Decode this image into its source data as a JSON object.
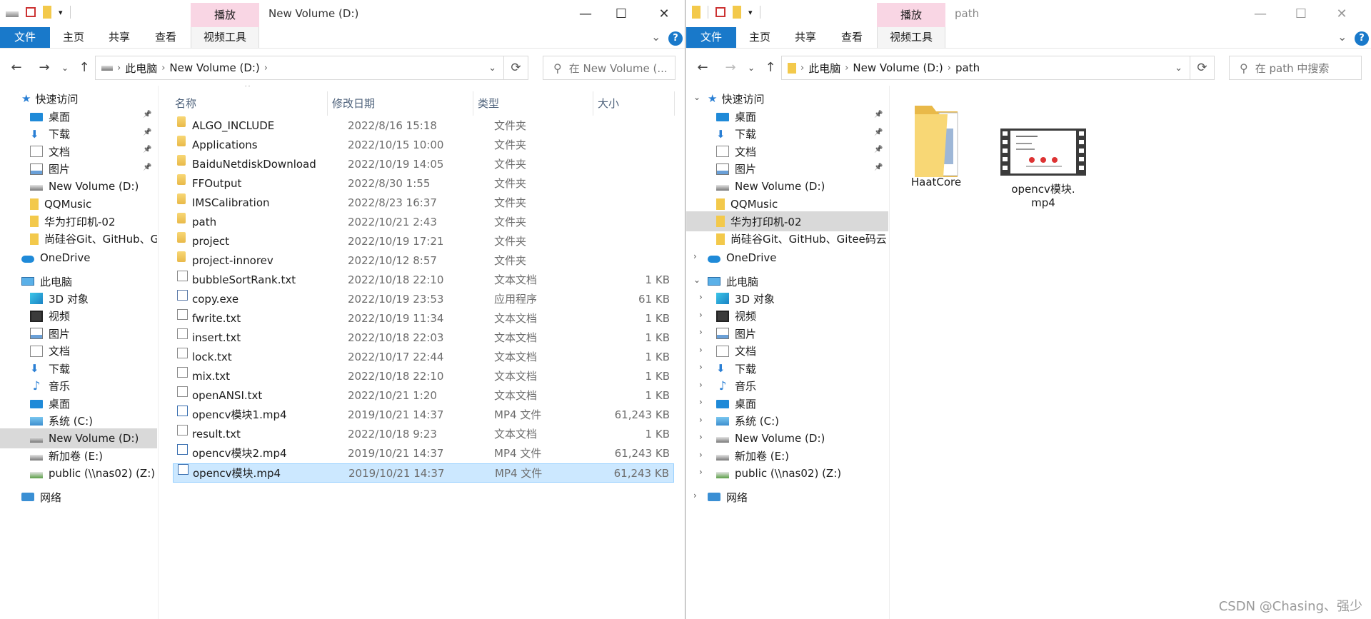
{
  "left": {
    "title": "New Volume (D:)",
    "context_tab_label": "播放",
    "ribbon_tabs": [
      "文件",
      "主页",
      "共享",
      "查看",
      "视频工具"
    ],
    "address": {
      "crumbs": [
        "此电脑",
        "New Volume (D:)"
      ]
    },
    "search_placeholder": "在 New Volume (...",
    "columns": {
      "name": "名称",
      "date": "修改日期",
      "type": "类型",
      "size": "大小"
    },
    "nav": {
      "quick_access": "快速访问",
      "quick_items": [
        "桌面",
        "下载",
        "文档",
        "图片",
        "New Volume (D:)",
        "QQMusic",
        "华为打印机-02",
        "尚硅谷Git、GitHub、G"
      ],
      "onedrive": "OneDrive",
      "this_pc": "此电脑",
      "pc_items": [
        "3D 对象",
        "视频",
        "图片",
        "文档",
        "下载",
        "音乐",
        "桌面",
        "系统 (C:)",
        "New Volume (D:)",
        "新加卷 (E:)",
        "public (\\\\nas02) (Z:)"
      ],
      "network": "网络"
    },
    "files": [
      {
        "name": "ALGO_INCLUDE",
        "date": "2022/8/16 15:18",
        "type": "文件夹",
        "size": "",
        "icon": "folder"
      },
      {
        "name": "Applications",
        "date": "2022/10/15 10:00",
        "type": "文件夹",
        "size": "",
        "icon": "folder"
      },
      {
        "name": "BaiduNetdiskDownload",
        "date": "2022/10/19 14:05",
        "type": "文件夹",
        "size": "",
        "icon": "folder"
      },
      {
        "name": "FFOutput",
        "date": "2022/8/30 1:55",
        "type": "文件夹",
        "size": "",
        "icon": "folder"
      },
      {
        "name": "IMSCalibration",
        "date": "2022/8/23 16:37",
        "type": "文件夹",
        "size": "",
        "icon": "folder"
      },
      {
        "name": "path",
        "date": "2022/10/21 2:43",
        "type": "文件夹",
        "size": "",
        "icon": "folder"
      },
      {
        "name": "project",
        "date": "2022/10/19 17:21",
        "type": "文件夹",
        "size": "",
        "icon": "folder"
      },
      {
        "name": "project-innorev",
        "date": "2022/10/12 8:57",
        "type": "文件夹",
        "size": "",
        "icon": "folder"
      },
      {
        "name": "bubbleSortRank.txt",
        "date": "2022/10/18 22:10",
        "type": "文本文档",
        "size": "1 KB",
        "icon": "file"
      },
      {
        "name": "copy.exe",
        "date": "2022/10/19 23:53",
        "type": "应用程序",
        "size": "61 KB",
        "icon": "exe"
      },
      {
        "name": "fwrite.txt",
        "date": "2022/10/19 11:34",
        "type": "文本文档",
        "size": "1 KB",
        "icon": "file"
      },
      {
        "name": "insert.txt",
        "date": "2022/10/18 22:03",
        "type": "文本文档",
        "size": "1 KB",
        "icon": "file"
      },
      {
        "name": "lock.txt",
        "date": "2022/10/17 22:44",
        "type": "文本文档",
        "size": "1 KB",
        "icon": "file"
      },
      {
        "name": "mix.txt",
        "date": "2022/10/18 22:10",
        "type": "文本文档",
        "size": "1 KB",
        "icon": "file"
      },
      {
        "name": "openANSI.txt",
        "date": "2022/10/21 1:20",
        "type": "文本文档",
        "size": "1 KB",
        "icon": "file"
      },
      {
        "name": "opencv模块1.mp4",
        "date": "2019/10/21 14:37",
        "type": "MP4 文件",
        "size": "61,243 KB",
        "icon": "mp4"
      },
      {
        "name": "result.txt",
        "date": "2022/10/18 9:23",
        "type": "文本文档",
        "size": "1 KB",
        "icon": "file"
      },
      {
        "name": "opencv模块2.mp4",
        "date": "2019/10/21 14:37",
        "type": "MP4 文件",
        "size": "61,243 KB",
        "icon": "mp4"
      },
      {
        "name": "opencv模块.mp4",
        "date": "2019/10/21 14:37",
        "type": "MP4 文件",
        "size": "61,243 KB",
        "icon": "mp4",
        "selected": true
      }
    ]
  },
  "right": {
    "title": "path",
    "context_tab_label": "播放",
    "ribbon_tabs": [
      "文件",
      "主页",
      "共享",
      "查看",
      "视频工具"
    ],
    "address": {
      "crumbs": [
        "此电脑",
        "New Volume (D:)",
        "path"
      ]
    },
    "search_placeholder": "在 path 中搜索",
    "nav": {
      "quick_access": "快速访问",
      "quick_items": [
        "桌面",
        "下载",
        "文档",
        "图片",
        "New Volume (D:)",
        "QQMusic",
        "华为打印机-02",
        "尚硅谷Git、GitHub、Gitee码云"
      ],
      "onedrive": "OneDrive",
      "this_pc": "此电脑",
      "pc_items": [
        "3D 对象",
        "视频",
        "图片",
        "文档",
        "下载",
        "音乐",
        "桌面",
        "系统 (C:)",
        "New Volume (D:)",
        "新加卷 (E:)",
        "public (\\\\nas02) (Z:)"
      ],
      "network": "网络"
    },
    "tiles": [
      {
        "line1": "HaatCore",
        "line2": "",
        "icon": "folder"
      },
      {
        "line1": "opencv模块.",
        "line2": "mp4",
        "icon": "video"
      }
    ]
  },
  "watermark": "CSDN @Chasing、强少"
}
